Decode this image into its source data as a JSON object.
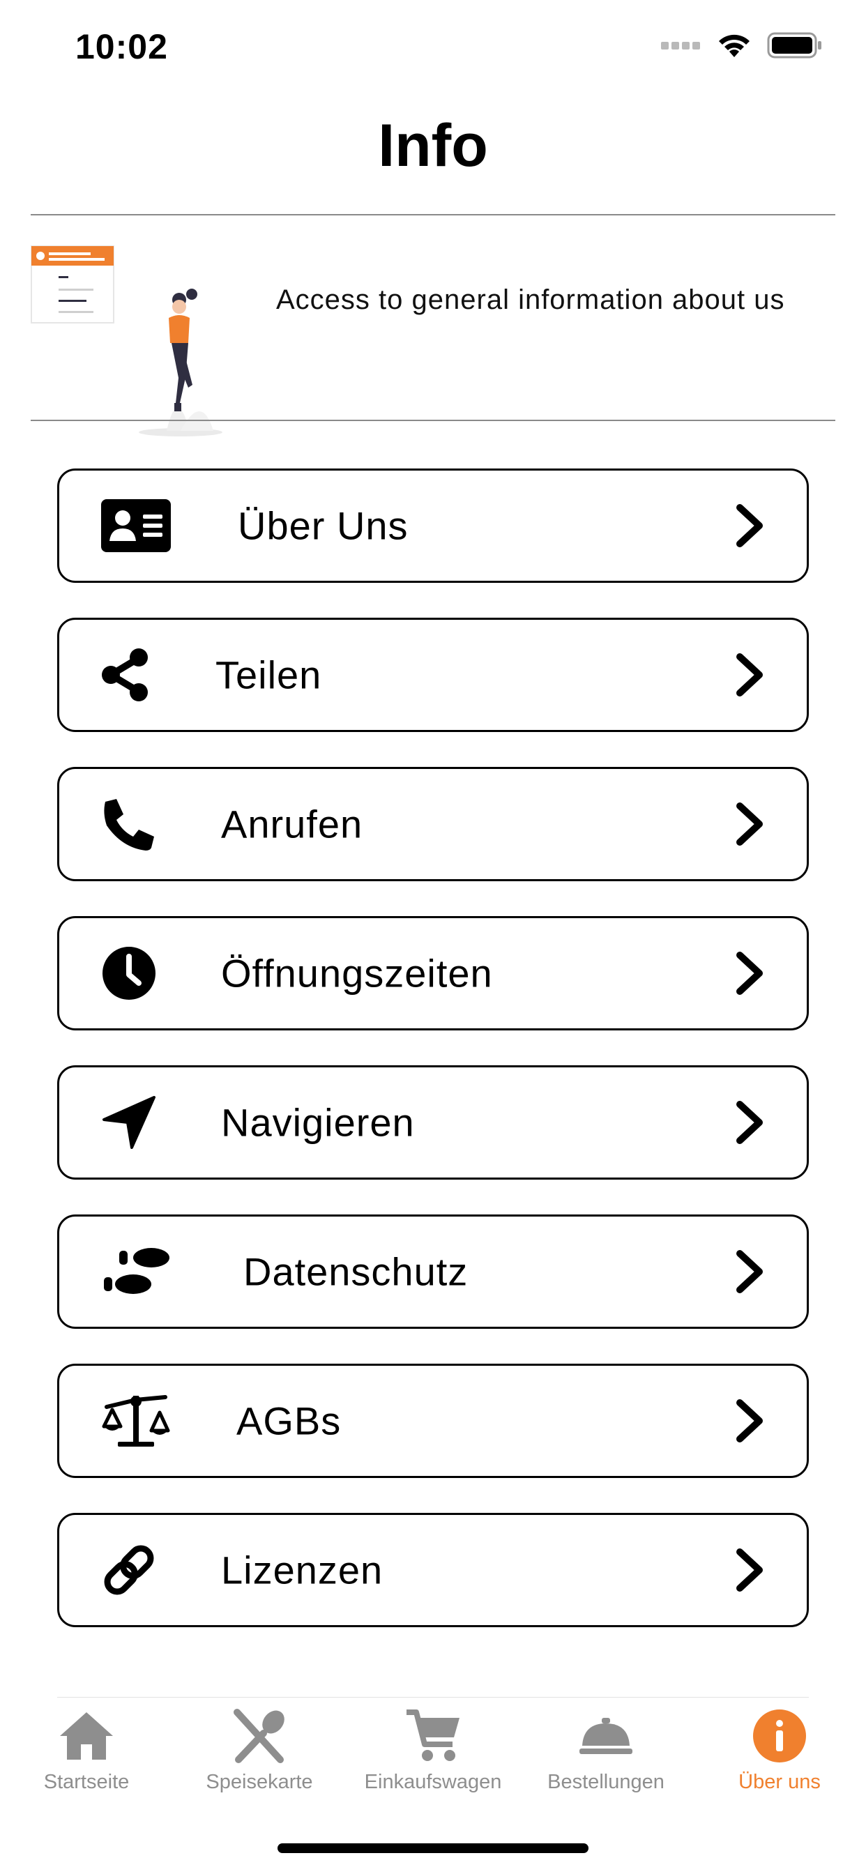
{
  "status_bar": {
    "time": "10:02"
  },
  "header": {
    "title": "Info"
  },
  "hero": {
    "description": "Access to general information about us"
  },
  "menu": {
    "items": [
      {
        "label": "Über Uns",
        "icon": "id-card-icon"
      },
      {
        "label": "Teilen",
        "icon": "share-icon"
      },
      {
        "label": "Anrufen",
        "icon": "phone-icon"
      },
      {
        "label": "Öffnungszeiten",
        "icon": "clock-icon"
      },
      {
        "label": "Navigieren",
        "icon": "location-arrow-icon"
      },
      {
        "label": "Datenschutz",
        "icon": "footprints-icon"
      },
      {
        "label": "AGBs",
        "icon": "balance-scale-icon"
      },
      {
        "label": "Lizenzen",
        "icon": "link-icon"
      }
    ]
  },
  "tabbar": {
    "tabs": [
      {
        "label": "Startseite",
        "icon": "home-icon",
        "active": false
      },
      {
        "label": "Speisekarte",
        "icon": "utensils-icon",
        "active": false
      },
      {
        "label": "Einkaufswagen",
        "icon": "cart-icon",
        "active": false
      },
      {
        "label": "Bestellungen",
        "icon": "cloche-icon",
        "active": false
      },
      {
        "label": "Über uns",
        "icon": "info-icon",
        "active": true
      }
    ]
  },
  "colors": {
    "accent": "#f0802e",
    "inactive": "#8e8e8e",
    "border": "#000000"
  }
}
